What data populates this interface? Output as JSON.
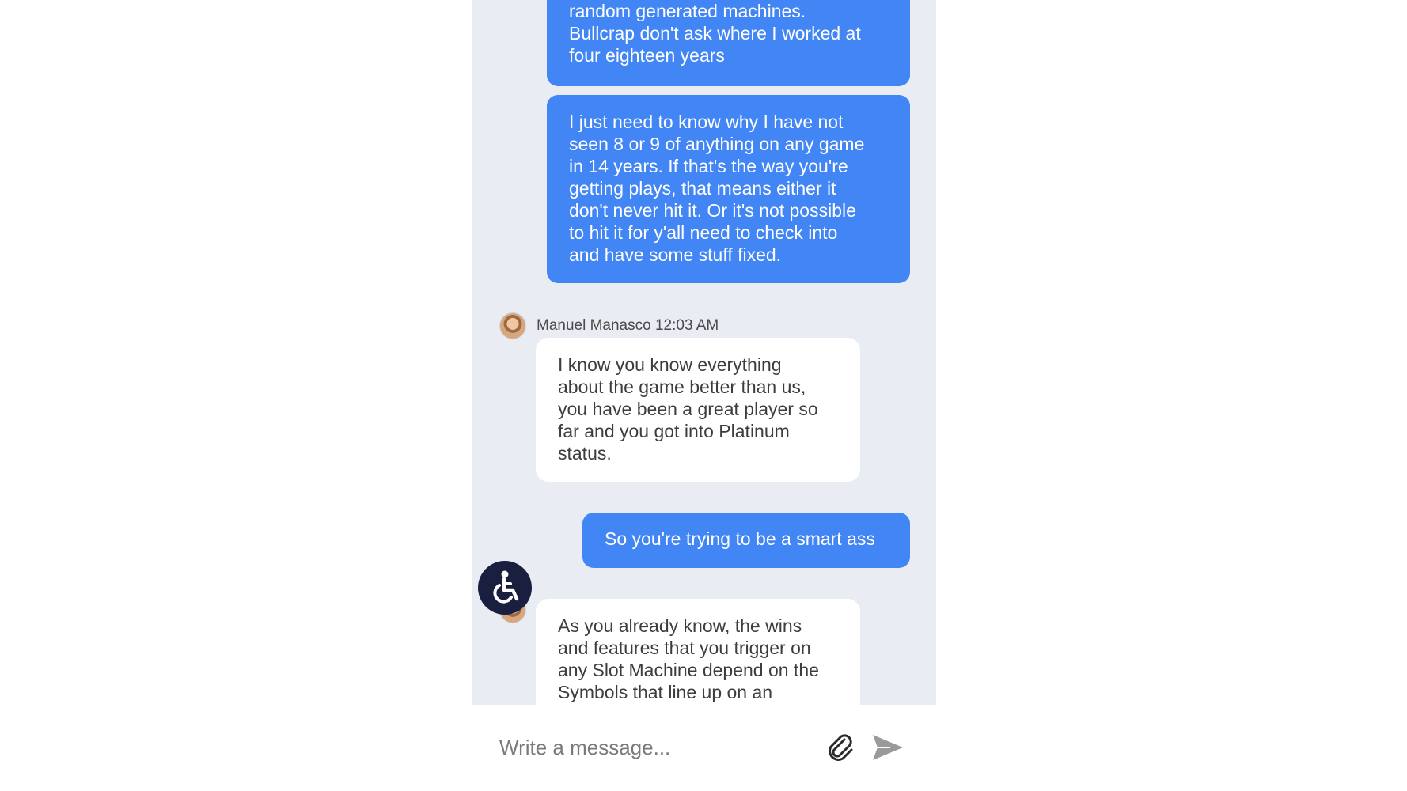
{
  "messages": [
    {
      "direction": "outgoing",
      "text": "random generated machines.\nBullcrap don't ask where I worked at\nfour eighteen years"
    },
    {
      "direction": "outgoing",
      "text": "I just need to know why I have not\nseen 8 or 9 of anything on any game\nin 14 years. If that's the way you're\ngetting plays, that means either it\ndon't never hit it. Or it's not possible\nto hit it for y'all need to check into\nand have some stuff fixed."
    },
    {
      "direction": "incoming",
      "sender": "Manuel Manasco",
      "time": "12:03 AM",
      "sender_line": "Manuel Manasco 12:03 AM",
      "text": "I know you know everything\nabout the game better than us,\nyou have been a great player so\nfar and you got into Platinum\nstatus."
    },
    {
      "direction": "outgoing",
      "text": "So you're trying to be a smart ass"
    },
    {
      "direction": "incoming",
      "text": "As you already know, the wins\nand features that you trigger on\nany Slot Machine depend on the\nSymbols that line up on an"
    }
  ],
  "composer": {
    "placeholder": "Write a message..."
  },
  "icons": {
    "accessibility": "accessibility-icon",
    "attach": "paperclip-icon",
    "send": "send-icon"
  },
  "colors": {
    "outgoing_bubble": "#4285f4",
    "incoming_bubble": "#ffffff",
    "chat_background": "#e9edf3",
    "accessibility_button": "#1b1f3f"
  }
}
